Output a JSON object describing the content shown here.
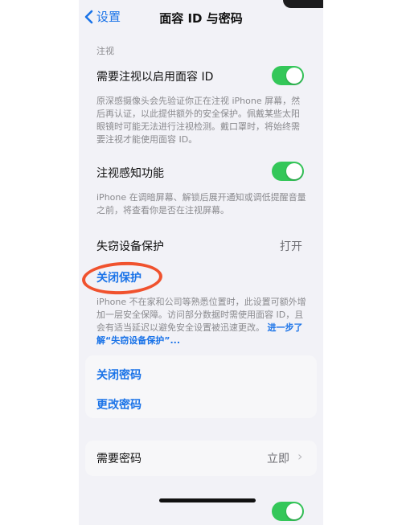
{
  "nav": {
    "back_label": "设置",
    "title": "面容 ID 与密码"
  },
  "attention": {
    "header": "注视",
    "require_attention_label": "需要注视以启用面容 ID",
    "require_attention_on": true,
    "require_attention_footer": "原深感摄像头会先验证你正在注视 iPhone 屏幕，然后再认证，以此提供额外的安全保护。佩戴某些太阳眼镜时可能无法进行注视检测。戴口罩时，将始终需要注视才能使用面容 ID。",
    "aware_label": "注视感知功能",
    "aware_on": true,
    "aware_footer": "iPhone 在调暗屏幕、解锁后展开通知或调低提醒音量之前，将查看你是否在注视屏幕。"
  },
  "theft": {
    "label": "失窃设备保护",
    "value": "打开",
    "turn_off_label": "关闭保护",
    "footer": "iPhone 不在家和公司等熟悉位置时，此设置可额外增加一层安全保障。访问部分数据时需使用面容 ID，且会有适当延迟以避免安全设置被迅速更改。",
    "learn_more": "进一步了解“失窃设备保护”..."
  },
  "passcode": {
    "turn_off_label": "关闭密码",
    "change_label": "更改密码"
  },
  "require_passcode": {
    "label": "需要密码",
    "value": "立即"
  },
  "colors": {
    "accent": "#1a73e8",
    "toggle_on": "#34c759",
    "annotation": "#f0522e"
  }
}
